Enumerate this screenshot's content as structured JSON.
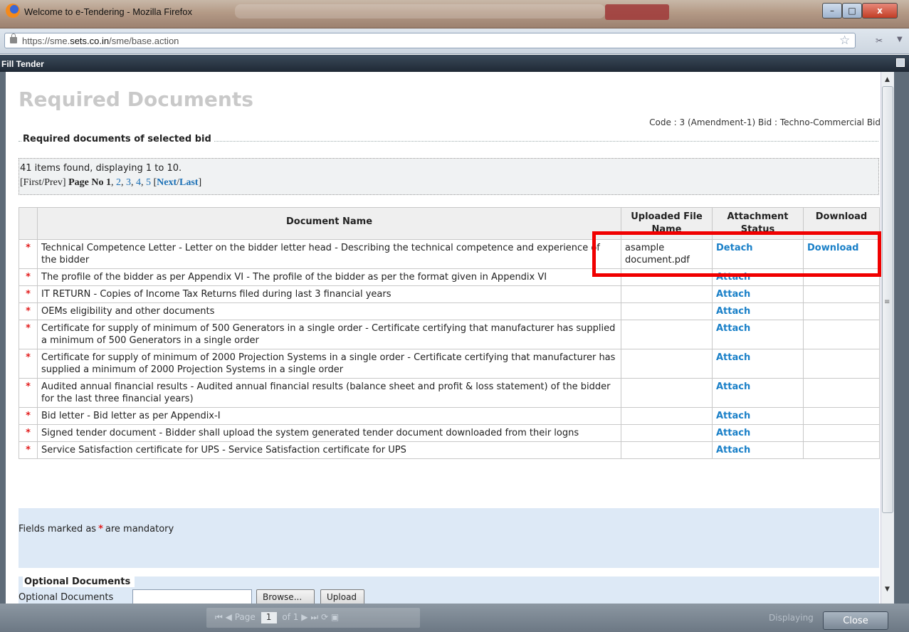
{
  "window": {
    "title": "Welcome to e-Tendering - Mozilla Firefox",
    "url_prefix": "https://sme.",
    "url_domain": "sets.co.in",
    "url_path": "/sme/base.action"
  },
  "panel": {
    "title": "Fill Tender"
  },
  "page": {
    "heading": "Required Documents",
    "code_line": "Code : 3 (Amendment-1) Bid : Techno-Commercial Bid",
    "section_title": "Required documents of selected bid",
    "summary": "41 items found, displaying 1 to 10.",
    "pager": {
      "first_prev": "[First/Prev]",
      "page_label": "Page No 1",
      "pages": [
        "2",
        "3",
        "4",
        "5"
      ],
      "next": "Next",
      "last": "Last"
    }
  },
  "table": {
    "headers": {
      "name": "Document Name",
      "file": "Uploaded File Name",
      "status": "Attachment Status",
      "download": "Download"
    },
    "rows": [
      {
        "name": "Technical Competence Letter - Letter on the bidder letter head - Describing the technical competence and experience of the bidder",
        "file": "asample document.pdf",
        "action": "Detach",
        "download": "Download"
      },
      {
        "name": "The profile of the bidder as per Appendix VI - The profile of the bidder as per the format given in Appendix VI",
        "file": "",
        "action": "Attach",
        "download": ""
      },
      {
        "name": "IT RETURN - Copies of Income Tax Returns filed during last 3 financial years",
        "file": "",
        "action": "Attach",
        "download": ""
      },
      {
        "name": "OEMs eligibility and other documents",
        "file": "",
        "action": "Attach",
        "download": ""
      },
      {
        "name": "Certificate for supply of minimum of 500 Generators in a single order - Certificate certifying that manufacturer has supplied a minimum of 500 Generators in a single order",
        "file": "",
        "action": "Attach",
        "download": ""
      },
      {
        "name": "Certificate for supply of minimum of 2000 Projection Systems in a single order - Certificate certifying that manufacturer has supplied a minimum of 2000 Projection Systems in a single order",
        "file": "",
        "action": "Attach",
        "download": ""
      },
      {
        "name": "Audited annual financial results - Audited annual financial results (balance sheet and profit & loss statement) of the bidder for the last three financial years)",
        "file": "",
        "action": "Attach",
        "download": ""
      },
      {
        "name": "Bid letter - Bid letter as per Appendix-I",
        "file": "",
        "action": "Attach",
        "download": ""
      },
      {
        "name": "Signed tender document - Bidder shall upload the system generated tender document downloaded from their logns",
        "file": "",
        "action": "Attach",
        "download": ""
      },
      {
        "name": "Service Satisfaction certificate for UPS - Service Satisfaction certificate for UPS",
        "file": "",
        "action": "Attach",
        "download": ""
      }
    ]
  },
  "mandatory_note": {
    "prefix": "Fields marked as",
    "suffix": "are mandatory"
  },
  "optional": {
    "title": "Optional Documents",
    "field_label": "Optional Documents",
    "browse": "Browse...",
    "upload": "Upload"
  },
  "statusbar": {
    "page_prefix": "Page",
    "page_value": "1",
    "page_of": "of 1",
    "displaying": "Displaying",
    "close": "Close"
  },
  "colors": {
    "highlight": "#f00000",
    "link": "#1a80c8",
    "mandatory_star": "#e21c1c"
  }
}
